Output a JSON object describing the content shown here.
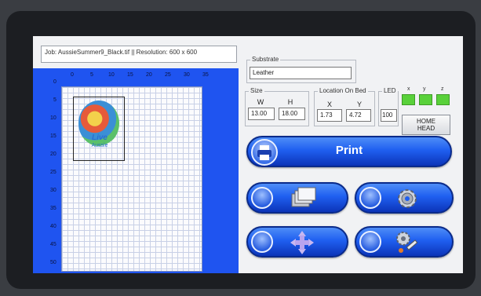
{
  "job_bar": {
    "text": "Job: AussieSummer9_Black.tif || Resolution: 600 x 600"
  },
  "bed": {
    "top_ruler": [
      "0",
      "5",
      "10",
      "15",
      "20",
      "25",
      "30",
      "35"
    ],
    "left_ruler": [
      "0",
      "5",
      "10",
      "15",
      "20",
      "25",
      "30",
      "35",
      "40",
      "45",
      "50"
    ],
    "art_line1": "Live",
    "art_line2": "Aussie"
  },
  "substrate": {
    "label": "Substrate",
    "value": "Leather"
  },
  "size": {
    "label": "Size",
    "w_label": "W",
    "h_label": "H",
    "w_value": "13.00",
    "h_value": "18.00"
  },
  "location": {
    "label": "Location On Bed",
    "x_label": "X",
    "y_label": "Y",
    "x_value": "1.73",
    "y_value": "4.72"
  },
  "led": {
    "label": "LED",
    "value": "100"
  },
  "axes": {
    "x": "x",
    "y": "y",
    "z": "z"
  },
  "home": {
    "line1": "HOME",
    "line2": "HEAD"
  },
  "print": {
    "label": "Print"
  },
  "colors": {
    "bed_blue": "#1f54f0",
    "button_blue": "#1f5ff0",
    "led_green": "#59d13a"
  }
}
